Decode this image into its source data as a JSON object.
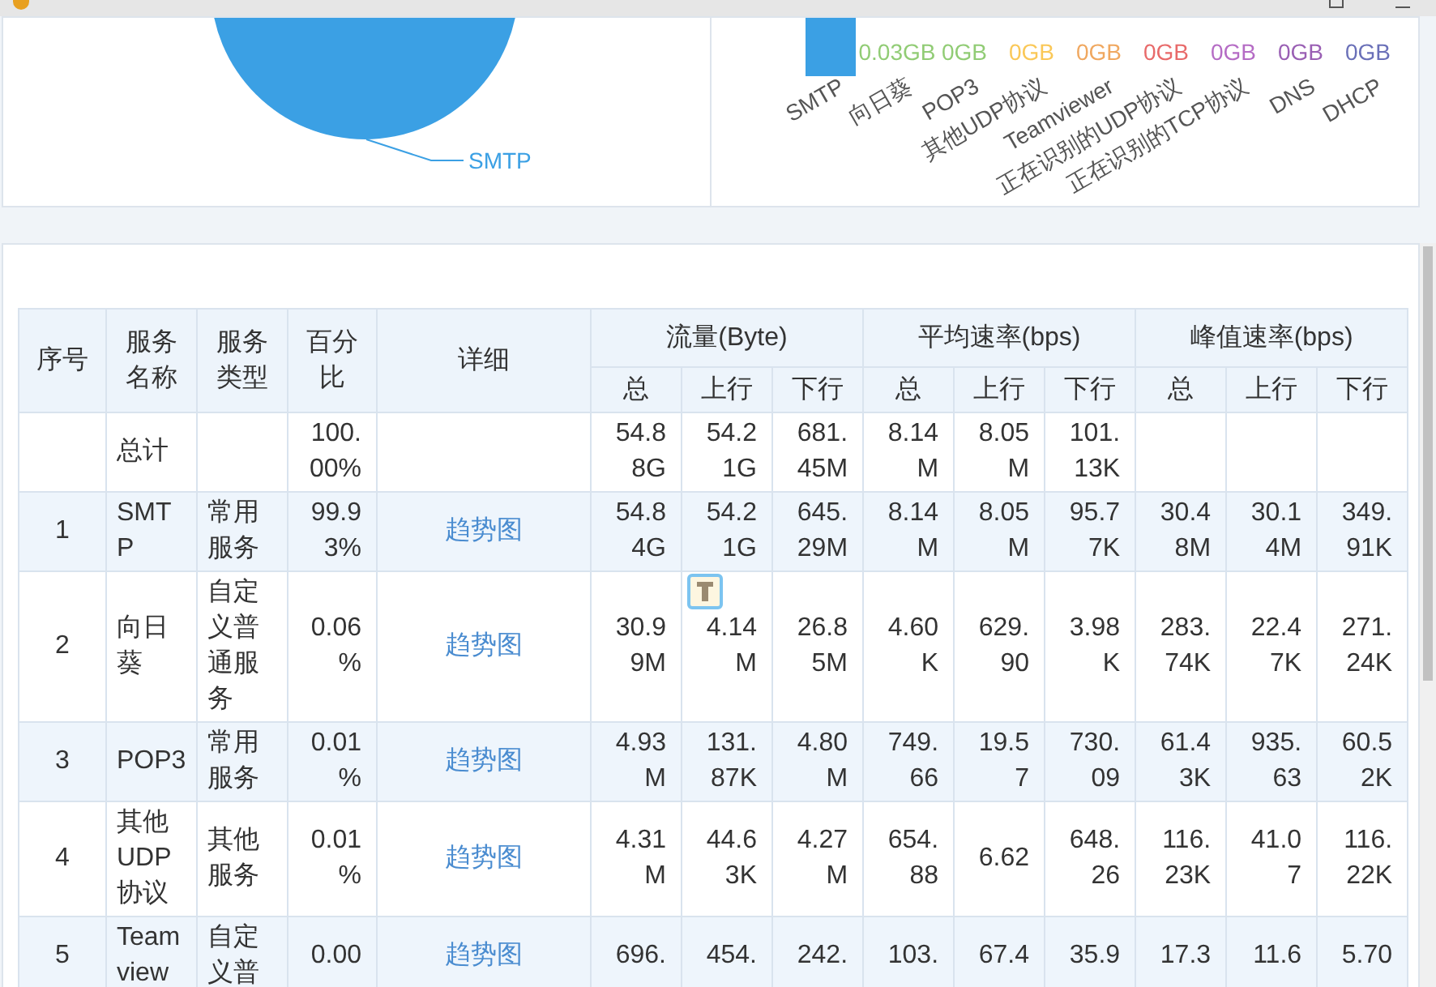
{
  "pie_chart": {
    "slice_label": "SMTP"
  },
  "bar_chart": {
    "bars": [
      {
        "category": "SMTP",
        "kind": "tall",
        "color": "#3ba0e4"
      },
      {
        "category": "向日葵",
        "value_label": "0.03GB",
        "kind": "flat",
        "color": "#91cc75"
      },
      {
        "category": "POP3",
        "value_label": "0GB",
        "kind": "flat",
        "color": "#91cc75"
      },
      {
        "category": "其他UDP协议",
        "value_label": "0GB",
        "kind": "flat",
        "color": "#fac858"
      },
      {
        "category": "Teamviewer",
        "value_label": "0GB",
        "kind": "flat",
        "color": "#f0a860"
      },
      {
        "category": "正在识别的UDP协议",
        "value_label": "0GB",
        "kind": "flat",
        "color": "#e86a6a"
      },
      {
        "category": "正在识别的TCP协议",
        "value_label": "0GB",
        "kind": "flat",
        "color": "#b56cc5"
      },
      {
        "category": "DNS",
        "value_label": "0GB",
        "kind": "flat",
        "color": "#9a60b4"
      },
      {
        "category": "DHCP",
        "value_label": "0GB",
        "kind": "flat",
        "color": "#6a70b8"
      }
    ]
  },
  "table": {
    "columns": [
      "序号",
      "服务名称",
      "服务类型",
      "百分比",
      "详细"
    ],
    "groups": [
      {
        "title": "流量(Byte)",
        "subcolumns": [
          "总",
          "上行",
          "下行"
        ]
      },
      {
        "title": "平均速率(bps)",
        "subcolumns": [
          "总",
          "上行",
          "下行"
        ]
      },
      {
        "title": "峰值速率(bps)",
        "subcolumns": [
          "总",
          "上行",
          "下行"
        ]
      }
    ],
    "rows": [
      {
        "name": "总计",
        "percent": "100.00%",
        "values": [
          "54.88G",
          "54.21G",
          "681.45M",
          "8.14M",
          "8.05M",
          "101.13K"
        ]
      },
      {
        "index": "1",
        "name": "SMTP",
        "type": "常用服务",
        "percent": "99.93%",
        "detail": "趋势图",
        "values": [
          "54.84G",
          "54.21G",
          "645.29M",
          "8.14M",
          "8.05M",
          "95.77K",
          "30.48M",
          "30.14M",
          "349.91K"
        ]
      },
      {
        "index": "2",
        "name": "向日葵",
        "type": "自定义普通服务",
        "percent": "0.06%",
        "detail": "趋势图",
        "values": [
          "30.99M",
          "4.14M",
          "26.85M",
          "4.60K",
          "629.90",
          "3.98K",
          "283.74K",
          "22.47K",
          "271.24K"
        ]
      },
      {
        "index": "3",
        "name": "POP3",
        "type": "常用服务",
        "percent": "0.01%",
        "detail": "趋势图",
        "values": [
          "4.93M",
          "131.87K",
          "4.80M",
          "749.66",
          "19.57",
          "730.09",
          "61.43K",
          "935.63",
          "60.52K"
        ]
      },
      {
        "index": "4",
        "name": "其他UDP协议",
        "type": "其他服务",
        "percent": "0.01%",
        "detail": "趋势图",
        "values": [
          "4.31M",
          "44.63K",
          "4.27M",
          "654.88",
          "6.62",
          "648.26",
          "116.23K",
          "41.07",
          "116.22K"
        ]
      },
      {
        "index": "5",
        "name": "Teamview",
        "type": "自定义普",
        "percent": "0.00",
        "detail": "趋势图",
        "values": [
          "696.",
          "454.",
          "242.",
          "103.",
          "67.4",
          "35.9",
          "17.3",
          "11.6",
          "5.70"
        ]
      }
    ]
  }
}
